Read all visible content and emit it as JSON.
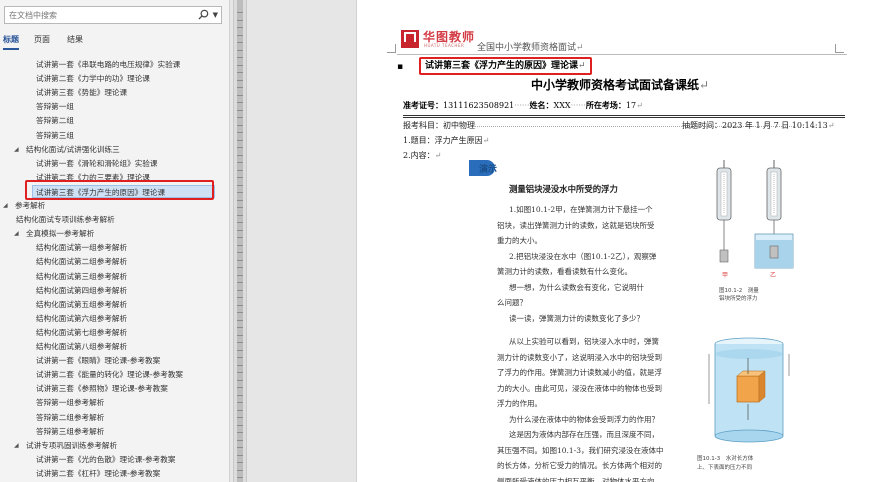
{
  "nav": {
    "search_placeholder": "在文档中搜索",
    "tabs": [
      "标题",
      "页面",
      "结果"
    ],
    "items": [
      {
        "text": "试讲第一套《串联电路的电压规律》实验课",
        "level": 2
      },
      {
        "text": "试讲第二套《力学中的功》理论课",
        "level": 2
      },
      {
        "text": "试讲第三套《势能》理论课",
        "level": 2
      },
      {
        "text": "答辩第一组",
        "level": 2
      },
      {
        "text": "答辩第二组",
        "level": 2
      },
      {
        "text": "答辩第三组",
        "level": 2
      },
      {
        "text": "结构化面试/试讲强化训练三",
        "level": 1,
        "expanded": true
      },
      {
        "text": "试讲第一套《滑轮和滑轮组》实验课",
        "level": 2
      },
      {
        "text": "试讲第二套《力的三要素》理论课",
        "level": 2
      },
      {
        "text": "试讲第三套《浮力产生的原因》理论课",
        "level": 2,
        "selected": true
      },
      {
        "text": "参考解析",
        "level": 0,
        "expanded": true
      },
      {
        "text": "结构化面试专项训练参考解析",
        "level": 1
      },
      {
        "text": "全真模拟一参考解析",
        "level": 1,
        "expanded": true
      },
      {
        "text": "结构化面试第一组参考解析",
        "level": 2
      },
      {
        "text": "结构化面试第二组参考解析",
        "level": 2
      },
      {
        "text": "结构化面试第三组参考解析",
        "level": 2
      },
      {
        "text": "结构化面试第四组参考解析",
        "level": 2
      },
      {
        "text": "结构化面试第五组参考解析",
        "level": 2
      },
      {
        "text": "结构化面试第六组参考解析",
        "level": 2
      },
      {
        "text": "结构化面试第七组参考解析",
        "level": 2
      },
      {
        "text": "结构化面试第八组参考解析",
        "level": 2
      },
      {
        "text": "试讲第一套《眼睛》理论课-参考教案",
        "level": 2
      },
      {
        "text": "试讲第二套《能量的转化》理论课-参考教案",
        "level": 2
      },
      {
        "text": "试讲第三套《参照物》理论课-参考教案",
        "level": 2
      },
      {
        "text": "答辩第一组参考解析",
        "level": 2
      },
      {
        "text": "答辩第二组参考解析",
        "level": 2
      },
      {
        "text": "答辩第三组参考解析",
        "level": 2
      },
      {
        "text": "试讲专项巩固训练参考解析",
        "level": 1,
        "expanded": true
      },
      {
        "text": "试讲第一套《光的色散》理论课-参考教案",
        "level": 2
      },
      {
        "text": "试讲第二套《杠杆》理论课-参考教案",
        "level": 2
      }
    ]
  },
  "doc": {
    "brand": "华图教师",
    "brand_sub": "HUATU TEACHER",
    "header_text": "全国中小学教师资格面试",
    "header_mark": "↵",
    "section_heading": "试讲第三套《浮力产生的原因》理论课",
    "para_mark": "↵",
    "title": "中小学教师资格考试面试备课纸",
    "exam_no_label": "准考证号：",
    "exam_no": "13111623508921",
    "name_label": "姓名：",
    "name": "XXX",
    "seat_label": "所在考场：",
    "seat": "17",
    "subject": "报考科目：初中物理",
    "draw_time": "抽题时间：2023 年 1 月 7 日 10:14:13",
    "q1": "1.题目：浮力产生原因",
    "q2": "2.内容：",
    "book": {
      "badge": "演示",
      "title": "测量铝块浸没水中所受的浮力",
      "lines": [
        "1.如图10.1-2甲，在弹簧测力计下悬挂一个",
        "铝块，读出弹簧测力计的读数，这就是铝块所受",
        "重力的大小。",
        "2.把铝块浸没在水中（图10.1-2乙），观察弹",
        "簧测力计的读数，看看读数有什么变化。",
        "想一想，为什么读数会有变化，它说明什",
        "么问题？",
        "读一读，弹簧测力计的读数变化了多少？"
      ],
      "para2": [
        "从以上实验可以看到，铝块浸入水中时，弹簧",
        "测力计的读数变小了，这说明浸入水中的铝块受到",
        "了浮力的作用。弹簧测力计读数减小的值，就是浮",
        "力的大小。由此可见，浸没在液体中的物体也受到",
        "浮力的作用。",
        "为什么浸在液体中的物体会受到浮力的作用？",
        "这是因为液体内部存在压强，而且深度不同，",
        "其压强不同。如图10.1-3，我们研究浸没在液体中",
        "的长方体，分析它受力的情况。长方体两个相对的",
        "侧面所受液体的压力相互平衡，对物体水平方向"
      ],
      "fig1_caption_1": "图10.1-2　测量",
      "fig1_caption_2": "铝块所受的浮力",
      "fig1_label_a": "甲",
      "fig1_label_b": "乙",
      "fig2_caption_1": "图10.1-3　水对长方体",
      "fig2_caption_2": "上、下表面的压力不同"
    }
  }
}
